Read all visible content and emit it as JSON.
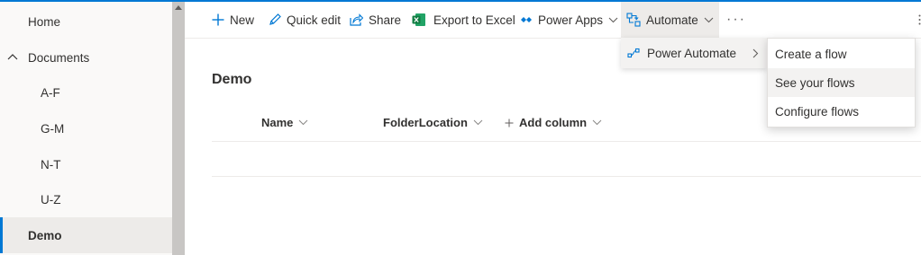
{
  "nav": {
    "items": [
      {
        "label": "Home"
      },
      {
        "label": "Documents"
      },
      {
        "label": "A-F"
      },
      {
        "label": "G-M"
      },
      {
        "label": "N-T"
      },
      {
        "label": "U-Z"
      },
      {
        "label": "Demo"
      }
    ]
  },
  "commandbar": {
    "new_label": "New",
    "quick_edit_label": "Quick edit",
    "share_label": "Share",
    "export_label": "Export to Excel",
    "power_apps_label": "Power Apps",
    "automate_label": "Automate",
    "more_label": "···"
  },
  "main": {
    "title": "Demo",
    "columns": [
      {
        "label": "Name"
      },
      {
        "label": "FolderLocation"
      },
      {
        "label": "Add column"
      }
    ]
  },
  "automate_menu": {
    "power_automate_label": "Power Automate"
  },
  "power_automate_submenu": {
    "items": [
      {
        "label": "Create a flow"
      },
      {
        "label": "See your flows"
      },
      {
        "label": "Configure flows"
      }
    ]
  },
  "colors": {
    "accent": "#0078d4",
    "excel_green": "#107c41",
    "selected_bg": "#edebe9"
  }
}
